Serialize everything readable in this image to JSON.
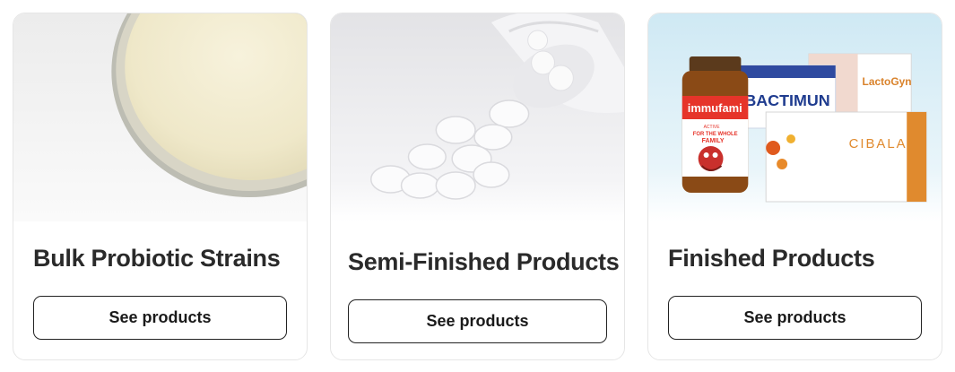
{
  "cards": [
    {
      "title": "Bulk Probiotic Strains",
      "button_label": "See products"
    },
    {
      "title": "Semi-Finished Products",
      "button_label": "See products"
    },
    {
      "title": "Finished Products",
      "button_label": "See products"
    }
  ],
  "product_box_texts": {
    "jar_brand": "immufami",
    "jar_line1": "ACTIVE",
    "jar_line2": "FOR THE WHOLE",
    "jar_line3": "FAMILY",
    "box1": "BACTIMUN",
    "box2": "LactoGyn",
    "box3": "CIBALAX"
  },
  "colors": {
    "card_border": "#e6e6e6",
    "title_text": "#2a2a2a",
    "button_border": "#222222",
    "finished_bg_top": "#cfe9f4"
  }
}
